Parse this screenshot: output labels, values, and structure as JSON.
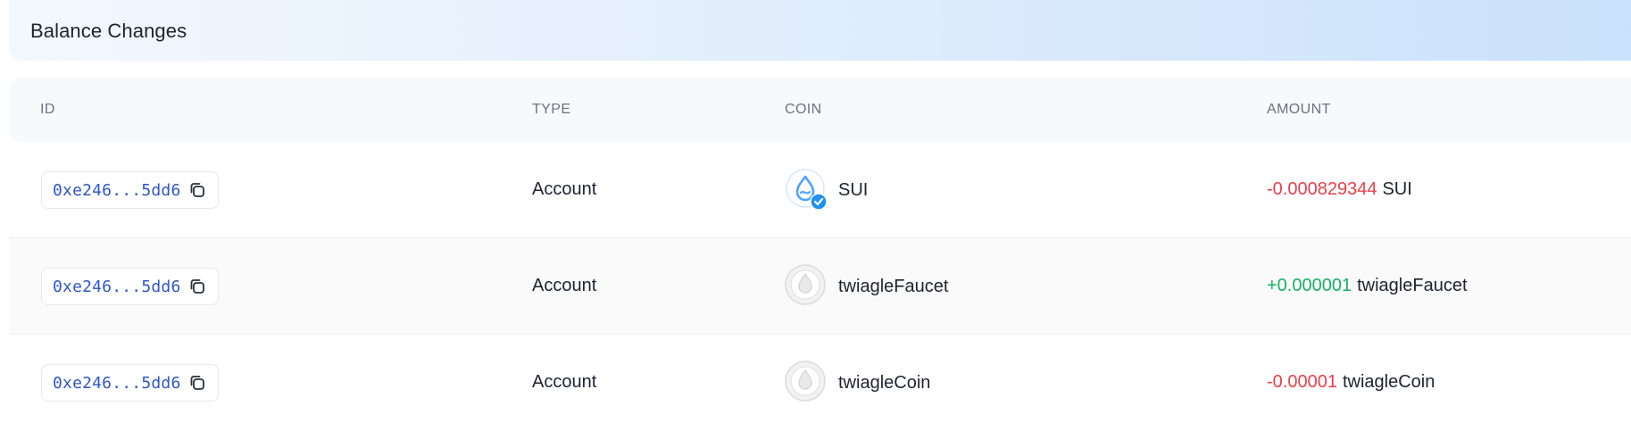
{
  "panel": {
    "title": "Balance Changes"
  },
  "table": {
    "columns": {
      "id": "ID",
      "type": "TYPE",
      "coin": "COIN",
      "amount": "AMOUNT"
    },
    "rows": [
      {
        "id": "0xe246...5dd6",
        "type": "Account",
        "coin": "SUI",
        "coin_icon": "sui-verified-icon",
        "amount": "-0.000829344",
        "amount_sign": "negative",
        "amount_symbol": "SUI"
      },
      {
        "id": "0xe246...5dd6",
        "type": "Account",
        "coin": "twiagleFaucet",
        "coin_icon": "generic-coin-icon",
        "amount": "+0.000001",
        "amount_sign": "positive",
        "amount_symbol": "twiagleFaucet"
      },
      {
        "id": "0xe246...5dd6",
        "type": "Account",
        "coin": "twiagleCoin",
        "coin_icon": "generic-coin-icon",
        "amount": "-0.00001",
        "amount_sign": "negative",
        "amount_symbol": "twiagleCoin"
      }
    ]
  },
  "colors": {
    "negative": "#ea3f4a",
    "positive": "#16b06a",
    "link": "#2e56c9",
    "sui_blue": "#4da2ff"
  }
}
